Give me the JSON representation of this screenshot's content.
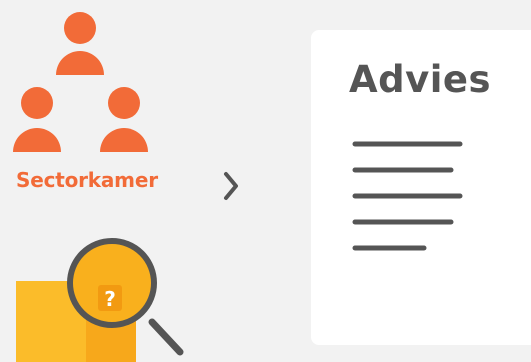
{
  "diagram": {
    "source": {
      "label": "Sectorkamer",
      "icon": "people-group-icon",
      "color": "#f26b38"
    },
    "arrow": {
      "icon": "chevron-right-icon",
      "color": "#555555"
    },
    "result": {
      "title": "Advies",
      "icon": "document-lines-icon"
    },
    "bottom_icon": {
      "icon": "folder-magnifier-icon",
      "folder_color": "#fbbc2a",
      "symbol": "?"
    }
  }
}
